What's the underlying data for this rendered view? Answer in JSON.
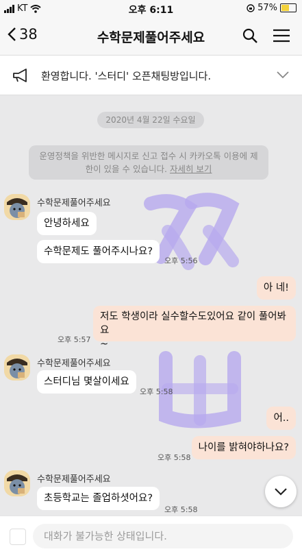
{
  "status_bar": {
    "carrier": "KT",
    "time": "오후 6:11",
    "battery": "57%"
  },
  "header": {
    "back_count": "38",
    "title": "수학문제풀어주세요",
    "icons": [
      "chevron-left-icon",
      "search-icon",
      "menu-icon"
    ]
  },
  "notice": {
    "text": "환영합니다. '스터디' 오픈채팅방입니다.",
    "icon": "megaphone-icon"
  },
  "chat": {
    "date": "2020년 4월 22일 수요일",
    "system_line1": "운영정책을 위반한 메시지로 신고 접수 시 카카오톡 이용에 제",
    "system_line2": "한이 있을 수 있습니다.",
    "system_link": "자세히 보기",
    "messages": [
      {
        "sender": "수학문제풀어주세요",
        "text": "안녕하세요"
      },
      {
        "text": "수학문제도 풀어주시나요?",
        "time": "오후 5:56"
      },
      {
        "text": "아 네!"
      },
      {
        "line1": "저도 학생이라 실수할수도있어요 같이 풀어봐요",
        "line2": "~",
        "time": "오후 5:57"
      },
      {
        "sender": "수학문제풀어주세요",
        "text": "스터디님 몇살이세요",
        "time": "오후 5:58"
      },
      {
        "text": "어.."
      },
      {
        "text": "나이를 밝혀야하나요?",
        "time": "오후 5:58"
      },
      {
        "sender": "수학문제풀어주세요",
        "text": "초등학교는 졸업하셧어요?",
        "time": "오후 5:58"
      }
    ]
  },
  "input": {
    "placeholder": "대화가 불가능한 상태입니다."
  },
  "colors": {
    "background": "#e9e9ea",
    "outgoing_bubble": "#fbe3d6",
    "incoming_bubble": "#ffffff",
    "watermark": "#b7a9ee"
  }
}
